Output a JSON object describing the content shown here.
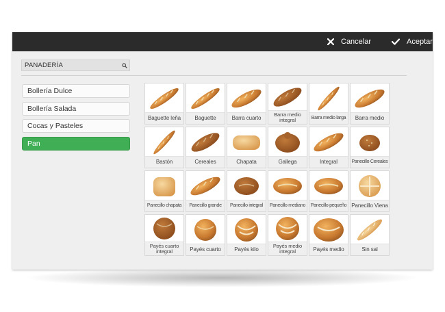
{
  "toolbar": {
    "cancel_label": "Cancelar",
    "accept_label": "Aceptar",
    "cancel_icon": "close-icon",
    "accept_icon": "check-icon"
  },
  "search": {
    "value": "PANADERÍA",
    "icon": "search-icon"
  },
  "categories": [
    {
      "label": "Bollería Dulce",
      "active": false
    },
    {
      "label": "Bollería Salada",
      "active": false
    },
    {
      "label": "Cocas y Pasteles",
      "active": false
    },
    {
      "label": "Pan",
      "active": true
    }
  ],
  "products": [
    {
      "label": "Baguette leña",
      "shape": "baguette-diag"
    },
    {
      "label": "Baguette",
      "shape": "baguette-diag"
    },
    {
      "label": "Barra cuarto",
      "shape": "barra-diag"
    },
    {
      "label": "Barra medio integral",
      "shape": "integral-diag"
    },
    {
      "label": "Barra medio larga",
      "shape": "thin-diag"
    },
    {
      "label": "Barra medio",
      "shape": "barra-diag"
    },
    {
      "label": "Bastón",
      "shape": "thin-diag"
    },
    {
      "label": "Cereales",
      "shape": "integral-diag"
    },
    {
      "label": "Chapata",
      "shape": "chapata"
    },
    {
      "label": "Gallega",
      "shape": "gallega"
    },
    {
      "label": "Integral",
      "shape": "barra-diag"
    },
    {
      "label": "Panecillo Cereales",
      "shape": "small-round"
    },
    {
      "label": "Panecillo chapata",
      "shape": "square-roll"
    },
    {
      "label": "Panecillo grande",
      "shape": "barra-diag"
    },
    {
      "label": "Panecillo integral",
      "shape": "oval-dark"
    },
    {
      "label": "Panecillo mediano",
      "shape": "oval"
    },
    {
      "label": "Panecillo pequeño",
      "shape": "oval"
    },
    {
      "label": "Panecillo Viena",
      "shape": "round-light"
    },
    {
      "label": "Payés cuarto integral",
      "shape": "round-dark"
    },
    {
      "label": "Payés cuarto",
      "shape": "round"
    },
    {
      "label": "Payés kilo",
      "shape": "round-floured"
    },
    {
      "label": "Payés medio integral",
      "shape": "round-floured"
    },
    {
      "label": "Payés medio",
      "shape": "round-big"
    },
    {
      "label": "Sin sal",
      "shape": "pale-diag"
    }
  ],
  "colors": {
    "topbar": "#2b2b2b",
    "active_category": "#3fae55",
    "crust": "#c8792f",
    "crust_dark": "#8a4a1c",
    "crumb": "#f0d9a8"
  }
}
